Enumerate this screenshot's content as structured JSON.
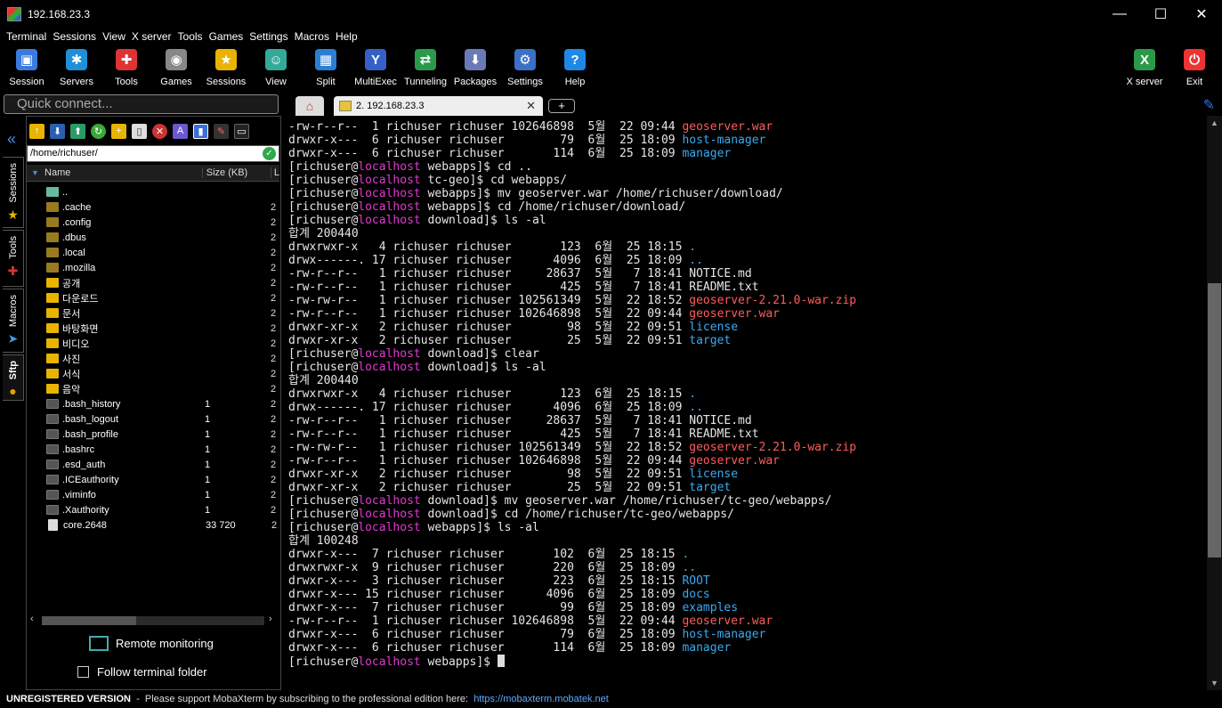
{
  "window": {
    "title": "192.168.23.3",
    "minimize": "—",
    "maximize": "☐",
    "close": "✕"
  },
  "menu": [
    "Terminal",
    "Sessions",
    "View",
    "X server",
    "Tools",
    "Games",
    "Settings",
    "Macros",
    "Help"
  ],
  "toolbar": [
    {
      "label": "Session",
      "icon": "session-icon",
      "color": "#3b7be0",
      "glyph": "▣"
    },
    {
      "label": "Servers",
      "icon": "servers-icon",
      "color": "#1f8fd8",
      "glyph": "✱"
    },
    {
      "label": "Tools",
      "icon": "tools-icon",
      "color": "#d33",
      "glyph": "✚"
    },
    {
      "label": "Games",
      "icon": "games-icon",
      "color": "#888",
      "glyph": "◉"
    },
    {
      "label": "Sessions",
      "icon": "star-icon",
      "color": "#e8b400",
      "glyph": "★"
    },
    {
      "label": "View",
      "icon": "view-icon",
      "color": "#3a9",
      "glyph": "☺"
    },
    {
      "label": "Split",
      "icon": "split-icon",
      "color": "#2a7fd4",
      "glyph": "▦"
    },
    {
      "label": "MultiExec",
      "icon": "multiexec-icon",
      "color": "#3560c8",
      "glyph": "Y"
    },
    {
      "label": "Tunneling",
      "icon": "tunneling-icon",
      "color": "#2a9a4a",
      "glyph": "⇄"
    },
    {
      "label": "Packages",
      "icon": "packages-icon",
      "color": "#6a7ab8",
      "glyph": "⬇"
    },
    {
      "label": "Settings",
      "icon": "settings-icon",
      "color": "#3a70c8",
      "glyph": "⚙"
    },
    {
      "label": "Help",
      "icon": "help-icon",
      "color": "#1e88e5",
      "glyph": "?"
    }
  ],
  "toolbar_right": [
    {
      "label": "X server",
      "icon": "xserver-icon",
      "color": "#2a9a4a",
      "glyph": "X"
    },
    {
      "label": "Exit",
      "icon": "exit-icon",
      "color": "#e33",
      "glyph": "⏻"
    }
  ],
  "quick_connect": {
    "placeholder": "Quick connect..."
  },
  "tabs": {
    "session_label": "2. 192.168.23.3",
    "close": "✕",
    "add": "+"
  },
  "side_tabs": [
    "Sessions",
    "Tools",
    "Macros",
    "Sftp"
  ],
  "sftp": {
    "path": "/home/richuser/",
    "headers": {
      "name": "Name",
      "size": "Size (KB)",
      "extra": "L"
    },
    "files": [
      {
        "name": "..",
        "size": "",
        "ext": "",
        "kind": "up"
      },
      {
        "name": ".cache",
        "size": "",
        "ext": "2",
        "kind": "hid"
      },
      {
        "name": ".config",
        "size": "",
        "ext": "2",
        "kind": "hid"
      },
      {
        "name": ".dbus",
        "size": "",
        "ext": "2",
        "kind": "hid"
      },
      {
        "name": ".local",
        "size": "",
        "ext": "2",
        "kind": "hid"
      },
      {
        "name": ".mozilla",
        "size": "",
        "ext": "2",
        "kind": "hid"
      },
      {
        "name": "공개",
        "size": "",
        "ext": "2",
        "kind": "dir"
      },
      {
        "name": "다운로드",
        "size": "",
        "ext": "2",
        "kind": "dir"
      },
      {
        "name": "문서",
        "size": "",
        "ext": "2",
        "kind": "dir"
      },
      {
        "name": "바탕화면",
        "size": "",
        "ext": "2",
        "kind": "dir"
      },
      {
        "name": "비디오",
        "size": "",
        "ext": "2",
        "kind": "dir"
      },
      {
        "name": "사진",
        "size": "",
        "ext": "2",
        "kind": "dir"
      },
      {
        "name": "서식",
        "size": "",
        "ext": "2",
        "kind": "dir"
      },
      {
        "name": "음악",
        "size": "",
        "ext": "2",
        "kind": "dir"
      },
      {
        "name": ".bash_history",
        "size": "1",
        "ext": "2",
        "kind": "file"
      },
      {
        "name": ".bash_logout",
        "size": "1",
        "ext": "2",
        "kind": "file"
      },
      {
        "name": ".bash_profile",
        "size": "1",
        "ext": "2",
        "kind": "file"
      },
      {
        "name": ".bashrc",
        "size": "1",
        "ext": "2",
        "kind": "file"
      },
      {
        "name": ".esd_auth",
        "size": "1",
        "ext": "2",
        "kind": "file"
      },
      {
        "name": ".ICEauthority",
        "size": "1",
        "ext": "2",
        "kind": "file"
      },
      {
        "name": ".viminfo",
        "size": "1",
        "ext": "2",
        "kind": "file"
      },
      {
        "name": ".Xauthority",
        "size": "1",
        "ext": "2",
        "kind": "file"
      },
      {
        "name": "core.2648",
        "size": "33 720",
        "ext": "2",
        "kind": "doc"
      }
    ],
    "remote_monitoring": "Remote monitoring",
    "follow_terminal": "Follow terminal folder"
  },
  "terminal": {
    "lines": [
      [
        [
          "-rw-r--r--  1 richuser richuser 102646898  5월  22 09:44 ",
          ""
        ],
        [
          "geoserver.war",
          "red"
        ]
      ],
      [
        [
          "drwxr-x---  6 richuser richuser        79  6월  25 18:09 ",
          ""
        ],
        [
          "host-manager",
          "blue"
        ]
      ],
      [
        [
          "drwxr-x---  6 richuser richuser       114  6월  25 18:09 ",
          ""
        ],
        [
          "manager",
          "blue"
        ]
      ],
      [
        [
          "[richuser@",
          ""
        ],
        [
          "localhost",
          "mag"
        ],
        [
          " webapps]$ cd ..",
          ""
        ]
      ],
      [
        [
          "[richuser@",
          ""
        ],
        [
          "localhost",
          "mag"
        ],
        [
          " tc-geo]$ cd webapps/",
          ""
        ]
      ],
      [
        [
          "[richuser@",
          ""
        ],
        [
          "localhost",
          "mag"
        ],
        [
          " webapps]$ mv geoserver.war /home/richuser/download/",
          ""
        ]
      ],
      [
        [
          "[richuser@",
          ""
        ],
        [
          "localhost",
          "mag"
        ],
        [
          " webapps]$ cd /home/richuser/download/",
          ""
        ]
      ],
      [
        [
          "[richuser@",
          ""
        ],
        [
          "localhost",
          "mag"
        ],
        [
          " download]$ ls -al",
          ""
        ]
      ],
      [
        [
          "합계 200440",
          ""
        ]
      ],
      [
        [
          "drwxrwxr-x   4 richuser richuser       123  6월  25 18:15 ",
          ""
        ],
        [
          ".",
          "blue"
        ]
      ],
      [
        [
          "drwx------. 17 richuser richuser      4096  6월  25 18:09 ",
          ""
        ],
        [
          "..",
          "blue"
        ]
      ],
      [
        [
          "-rw-r--r--   1 richuser richuser     28637  5월   7 18:41 NOTICE.md",
          ""
        ]
      ],
      [
        [
          "-rw-r--r--   1 richuser richuser       425  5월   7 18:41 README.txt",
          ""
        ]
      ],
      [
        [
          "-rw-rw-r--   1 richuser richuser 102561349  5월  22 18:52 ",
          ""
        ],
        [
          "geoserver-2.21.0-war.zip",
          "red"
        ]
      ],
      [
        [
          "-rw-r--r--   1 richuser richuser 102646898  5월  22 09:44 ",
          ""
        ],
        [
          "geoserver.war",
          "red"
        ]
      ],
      [
        [
          "drwxr-xr-x   2 richuser richuser        98  5월  22 09:51 ",
          ""
        ],
        [
          "license",
          "blue"
        ]
      ],
      [
        [
          "drwxr-xr-x   2 richuser richuser        25  5월  22 09:51 ",
          ""
        ],
        [
          "target",
          "blue"
        ]
      ],
      [
        [
          "[richuser@",
          ""
        ],
        [
          "localhost",
          "mag"
        ],
        [
          " download]$ clear",
          ""
        ]
      ],
      [
        [
          "[richuser@",
          ""
        ],
        [
          "localhost",
          "mag"
        ],
        [
          " download]$ ls -al",
          ""
        ]
      ],
      [
        [
          "합계 200440",
          ""
        ]
      ],
      [
        [
          "drwxrwxr-x   4 richuser richuser       123  6월  25 18:15 ",
          ""
        ],
        [
          ".",
          "blue"
        ]
      ],
      [
        [
          "drwx------. 17 richuser richuser      4096  6월  25 18:09 ",
          ""
        ],
        [
          "..",
          "blue"
        ]
      ],
      [
        [
          "-rw-r--r--   1 richuser richuser     28637  5월   7 18:41 NOTICE.md",
          ""
        ]
      ],
      [
        [
          "-rw-r--r--   1 richuser richuser       425  5월   7 18:41 README.txt",
          ""
        ]
      ],
      [
        [
          "-rw-rw-r--   1 richuser richuser 102561349  5월  22 18:52 ",
          ""
        ],
        [
          "geoserver-2.21.0-war.zip",
          "red"
        ]
      ],
      [
        [
          "-rw-r--r--   1 richuser richuser 102646898  5월  22 09:44 ",
          ""
        ],
        [
          "geoserver.war",
          "red"
        ]
      ],
      [
        [
          "drwxr-xr-x   2 richuser richuser        98  5월  22 09:51 ",
          ""
        ],
        [
          "license",
          "blue"
        ]
      ],
      [
        [
          "drwxr-xr-x   2 richuser richuser        25  5월  22 09:51 ",
          ""
        ],
        [
          "target",
          "blue"
        ]
      ],
      [
        [
          "[richuser@",
          ""
        ],
        [
          "localhost",
          "mag"
        ],
        [
          " download]$ mv geoserver.war /home/richuser/tc-geo/webapps/",
          ""
        ]
      ],
      [
        [
          "[richuser@",
          ""
        ],
        [
          "localhost",
          "mag"
        ],
        [
          " download]$ cd /home/richuser/tc-geo/webapps/",
          ""
        ]
      ],
      [
        [
          "[richuser@",
          ""
        ],
        [
          "localhost",
          "mag"
        ],
        [
          " webapps]$ ls -al",
          ""
        ]
      ],
      [
        [
          "합계 100248",
          ""
        ]
      ],
      [
        [
          "drwxr-x---  7 richuser richuser       102  6월  25 18:15 ",
          ""
        ],
        [
          ".",
          "blue"
        ]
      ],
      [
        [
          "drwxrwxr-x  9 richuser richuser       220  6월  25 18:09 ",
          ""
        ],
        [
          "..",
          "blue"
        ]
      ],
      [
        [
          "drwxr-x---  3 richuser richuser       223  6월  25 18:15 ",
          ""
        ],
        [
          "ROOT",
          "blue"
        ]
      ],
      [
        [
          "drwxr-x--- 15 richuser richuser      4096  6월  25 18:09 ",
          ""
        ],
        [
          "docs",
          "blue"
        ]
      ],
      [
        [
          "drwxr-x---  7 richuser richuser        99  6월  25 18:09 ",
          ""
        ],
        [
          "examples",
          "blue"
        ]
      ],
      [
        [
          "-rw-r--r--  1 richuser richuser 102646898  5월  22 09:44 ",
          ""
        ],
        [
          "geoserver.war",
          "red"
        ]
      ],
      [
        [
          "drwxr-x---  6 richuser richuser        79  6월  25 18:09 ",
          ""
        ],
        [
          "host-manager",
          "blue"
        ]
      ],
      [
        [
          "drwxr-x---  6 richuser richuser       114  6월  25 18:09 ",
          ""
        ],
        [
          "manager",
          "blue"
        ]
      ],
      [
        [
          "[richuser@",
          ""
        ],
        [
          "localhost",
          "mag"
        ],
        [
          " webapps]$ ",
          ""
        ]
      ]
    ]
  },
  "status": {
    "unregistered": "UNREGISTERED VERSION",
    "message": "  -  Please support MobaXterm by subscribing to the professional edition here:  ",
    "link": "https://mobaxterm.mobatek.net"
  }
}
